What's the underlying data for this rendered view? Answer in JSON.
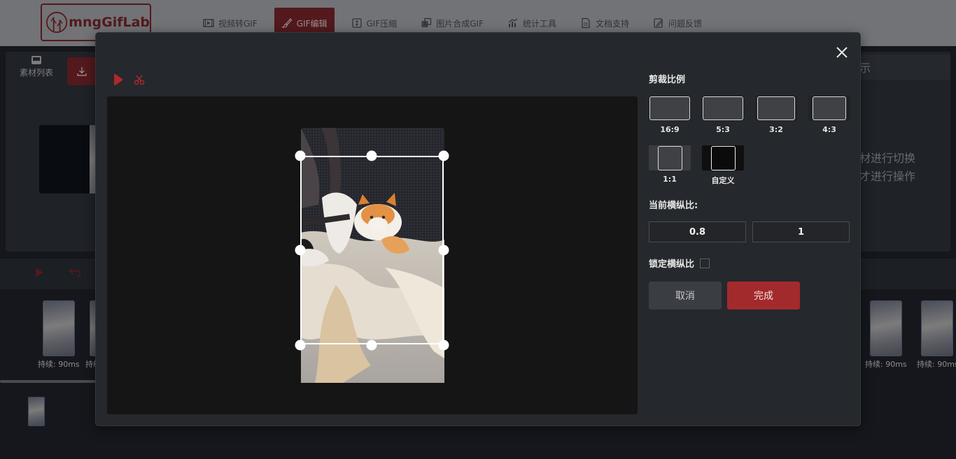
{
  "app": {
    "logo_text": "mngGifLab",
    "nav": [
      {
        "label": "视频转GIF",
        "icon": "film-icon",
        "active": false
      },
      {
        "label": "GIF编辑",
        "icon": "brush-icon",
        "active": true
      },
      {
        "label": "GIF压缩",
        "icon": "compress-icon",
        "active": false
      },
      {
        "label": "图片合成GIF",
        "icon": "images-icon",
        "active": false
      },
      {
        "label": "统计工具",
        "icon": "chart-icon",
        "active": false
      },
      {
        "label": "文档支持",
        "icon": "document-icon",
        "active": false
      },
      {
        "label": "问题反馈",
        "icon": "feedback-icon",
        "active": false
      }
    ]
  },
  "background": {
    "left_tab_label": "素材列表",
    "right_header_text": "示",
    "right_hint_lines": [
      "材进行切换",
      "才进行操作"
    ],
    "frame_duration_label": "持续: 90ms",
    "frame_duration_label_cut": "持续",
    "frame_duration_label_right_cut": "持续: 90ms"
  },
  "dialog": {
    "crop_ratio_title": "剪裁比例",
    "ratios": [
      {
        "label": "16:9"
      },
      {
        "label": "5:3"
      },
      {
        "label": "3:2"
      },
      {
        "label": "4:3"
      },
      {
        "label": "1:1"
      },
      {
        "label": "自定义"
      }
    ],
    "current_ratio_title": "当前横纵比:",
    "ratio_width": "0.8",
    "ratio_height": "1",
    "lock_ratio_label": "锁定横纵比",
    "lock_ratio_checked": false,
    "cancel_label": "取消",
    "done_label": "完成"
  },
  "colors": {
    "accent": "#a32a2c",
    "nav_active": "#7a1f24",
    "modal_bg": "#25282c",
    "stage_bg": "#151515"
  }
}
